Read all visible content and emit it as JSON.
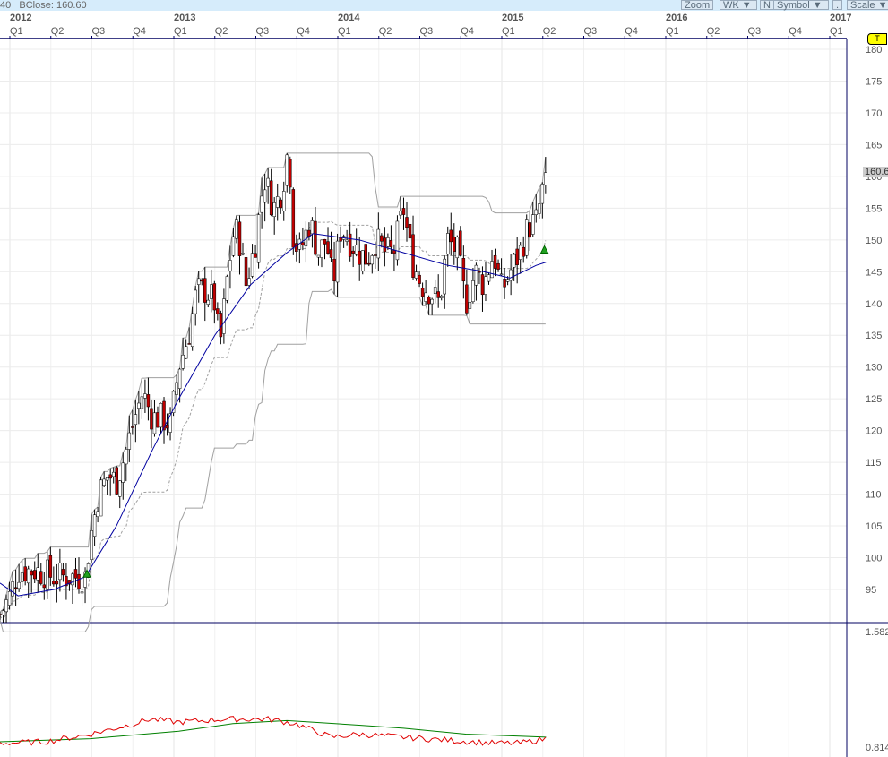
{
  "header": {
    "left_text": "40   BClose: 160.60",
    "zoom": "Zoom",
    "interval": "WK",
    "n": "N",
    "symbol": "Symbol",
    "dot": ".",
    "scale": "Scale",
    "dropdown_glyph": "▼"
  },
  "tag": {
    "label": "T",
    "color": "#ffff00"
  },
  "last_price_label": "160.6",
  "colors": {
    "up": "#000000",
    "down": "#c00000",
    "ma": "#0000a0",
    "channel": "#a0a0a0",
    "rs": "#e00000",
    "rs_ma": "#008000",
    "axis": "#000060",
    "marker": "#20a020"
  },
  "chart_data": {
    "type": "candlestick",
    "years": [
      "2012",
      "2013",
      "2014",
      "2015",
      "2016",
      "2017"
    ],
    "quarters": [
      "Q1",
      "Q2",
      "Q3",
      "Q4"
    ],
    "y_ticks": [
      180,
      175,
      170,
      165,
      160,
      155,
      150,
      145,
      140,
      135,
      130,
      125,
      120,
      115,
      110,
      105,
      100,
      95
    ],
    "ylim": [
      92,
      181
    ],
    "xlim": [
      2011.94,
      2017.1
    ],
    "close": [
      [
        2011.94,
        91
      ],
      [
        2012.0,
        94
      ],
      [
        2012.05,
        98
      ],
      [
        2012.16,
        98
      ],
      [
        2012.27,
        97
      ],
      [
        2012.38,
        97
      ],
      [
        2012.46,
        97
      ],
      [
        2012.49,
        103
      ],
      [
        2012.54,
        110
      ],
      [
        2012.6,
        113
      ],
      [
        2012.65,
        112
      ],
      [
        2012.7,
        116
      ],
      [
        2012.76,
        122
      ],
      [
        2012.81,
        126
      ],
      [
        2012.87,
        122
      ],
      [
        2012.92,
        122
      ],
      [
        2012.98,
        121
      ],
      [
        2013.03,
        130
      ],
      [
        2013.09,
        135
      ],
      [
        2013.14,
        142
      ],
      [
        2013.2,
        142
      ],
      [
        2013.25,
        140
      ],
      [
        2013.28,
        133
      ],
      [
        2013.33,
        145
      ],
      [
        2013.37,
        152
      ],
      [
        2013.4,
        150
      ],
      [
        2013.44,
        143
      ],
      [
        2013.5,
        150
      ],
      [
        2013.55,
        160
      ],
      [
        2013.61,
        155
      ],
      [
        2013.66,
        158
      ],
      [
        2013.7,
        165
      ],
      [
        2013.73,
        150
      ],
      [
        2013.77,
        148
      ],
      [
        2013.83,
        153
      ],
      [
        2013.88,
        148
      ],
      [
        2013.93,
        150
      ],
      [
        2013.97,
        143
      ],
      [
        2014.02,
        152
      ],
      [
        2014.07,
        150
      ],
      [
        2014.13,
        148
      ],
      [
        2014.18,
        147
      ],
      [
        2014.23,
        150
      ],
      [
        2014.29,
        148
      ],
      [
        2014.34,
        148
      ],
      [
        2014.4,
        155
      ],
      [
        2014.45,
        147
      ],
      [
        2014.51,
        143
      ],
      [
        2014.56,
        142
      ],
      [
        2014.62,
        140
      ],
      [
        2014.67,
        150
      ],
      [
        2014.73,
        148
      ],
      [
        2014.78,
        140
      ],
      [
        2014.84,
        145
      ],
      [
        2014.89,
        143
      ],
      [
        2014.95,
        148
      ],
      [
        2015.0,
        142
      ],
      [
        2015.05,
        145
      ],
      [
        2015.11,
        148
      ],
      [
        2015.16,
        152
      ],
      [
        2015.21,
        153
      ],
      [
        2015.27,
        160.6
      ]
    ],
    "ma": [
      [
        2011.94,
        96
      ],
      [
        2012.05,
        94
      ],
      [
        2012.27,
        95
      ],
      [
        2012.46,
        97
      ],
      [
        2012.65,
        105
      ],
      [
        2012.87,
        117
      ],
      [
        2013.03,
        125
      ],
      [
        2013.25,
        135
      ],
      [
        2013.47,
        143
      ],
      [
        2013.69,
        148
      ],
      [
        2013.85,
        151
      ],
      [
        2014.13,
        150
      ],
      [
        2014.4,
        148
      ],
      [
        2014.67,
        146
      ],
      [
        2014.89,
        145
      ],
      [
        2015.05,
        144
      ],
      [
        2015.21,
        146
      ],
      [
        2015.27,
        146.5
      ]
    ],
    "rs": {
      "ylim": [
        0.814,
        1.582
      ],
      "tick_labels": [
        "1.582",
        "0.814"
      ],
      "line": [
        [
          2011.94,
          0.84
        ],
        [
          2012.22,
          0.85
        ],
        [
          2012.49,
          0.9
        ],
        [
          2012.76,
          0.97
        ],
        [
          2012.85,
          1.0
        ],
        [
          2013.03,
          0.98
        ],
        [
          2013.31,
          1.0
        ],
        [
          2013.58,
          1.0
        ],
        [
          2013.74,
          0.97
        ],
        [
          2013.96,
          0.88
        ],
        [
          2014.13,
          0.9
        ],
        [
          2014.4,
          0.88
        ],
        [
          2014.67,
          0.86
        ],
        [
          2014.95,
          0.84
        ],
        [
          2015.11,
          0.84
        ],
        [
          2015.27,
          0.87
        ]
      ],
      "ma": [
        [
          2011.94,
          0.85
        ],
        [
          2012.49,
          0.87
        ],
        [
          2013.03,
          0.92
        ],
        [
          2013.36,
          0.97
        ],
        [
          2013.69,
          0.99
        ],
        [
          2014.13,
          0.96
        ],
        [
          2014.4,
          0.94
        ],
        [
          2014.78,
          0.9
        ],
        [
          2015.27,
          0.88
        ]
      ]
    },
    "markers": [
      {
        "type": "buy-triangle",
        "t": 2012.47,
        "price": 97.5
      },
      {
        "type": "buy-triangle",
        "t": 2015.26,
        "price": 148.5
      }
    ]
  }
}
